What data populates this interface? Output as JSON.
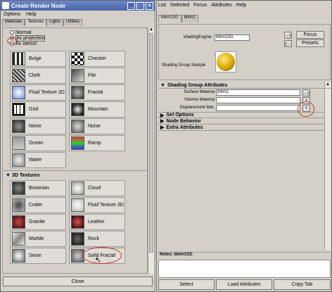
{
  "left": {
    "title": "Create Render Node",
    "menu": [
      "Options",
      "Help"
    ],
    "tabs": [
      "Materials",
      "Textures",
      "Lights",
      "Utilities"
    ],
    "radios": [
      "Normal",
      "As projection",
      "As stencil"
    ],
    "textures2d": [
      [
        "Bulge",
        "Checker"
      ],
      [
        "Cloth",
        "File"
      ],
      [
        "Fluid Texture 2D",
        "Fractal"
      ],
      [
        "Grid",
        "Mountain"
      ],
      [
        "Noise",
        "Noise"
      ],
      [
        "Ocean",
        "Ramp"
      ],
      [
        "Water",
        ""
      ]
    ],
    "section3d": "3D Textures",
    "textures3d": [
      [
        "Brownian",
        "Cloud"
      ],
      [
        "Crater",
        "Fluid Texture 3D"
      ],
      [
        "Granite",
        "Leather"
      ],
      [
        "Marble",
        "Rock"
      ],
      [
        "Snow",
        "Solid Fractal"
      ]
    ],
    "close": "Close"
  },
  "right": {
    "menu": [
      "List",
      "Selected",
      "Focus",
      "Attributes",
      "Help"
    ],
    "tab": "blinn1SG",
    "tab2": "blinn1",
    "shadingEngineLabel": "shadingEngine:",
    "shadingEngineValue": "blinn1SG",
    "focus": "Focus",
    "presets": "Presets",
    "sampleLabel": "Shading Group Sample",
    "sectionMain": "Shading Group Attributes",
    "surfaceLabel": "Surface Material",
    "surfaceValue": "blinn1",
    "volumeLabel": "Volume Material",
    "displacementLabel": "Displacement Mat.",
    "sections": [
      "Set Options",
      "Node Behavior",
      "Extra Attributes"
    ],
    "notes": "Notes: blinn1SG",
    "buttons": [
      "Select",
      "Load Attributes",
      "Copy Tab"
    ]
  },
  "colors": {
    "title": "#4a64a8",
    "annotation": "#c0392b"
  }
}
